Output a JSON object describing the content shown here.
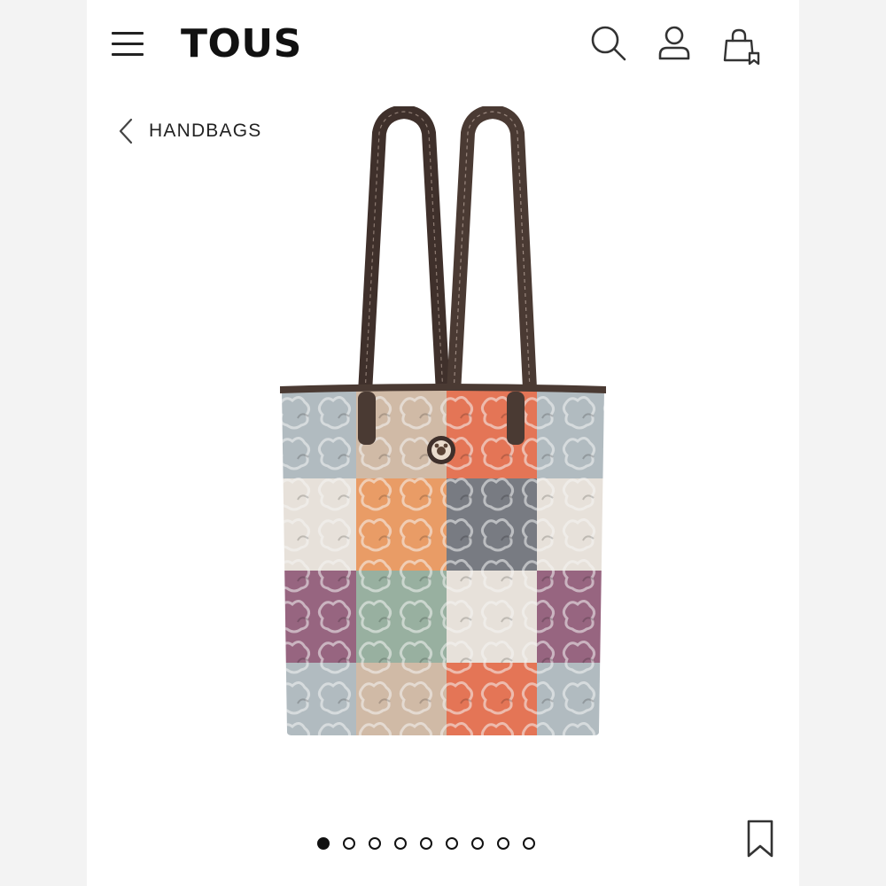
{
  "header": {
    "brand": "TOUS",
    "icons": [
      "menu-icon",
      "search-icon",
      "user-icon",
      "shopping-bag-icon"
    ]
  },
  "breadcrumb": {
    "label": "HANDBAGS",
    "icon": "chevron-left-icon"
  },
  "product": {
    "image": "tote-bag-image",
    "colors": {
      "strap": "#4a3a33",
      "blue_grey": "#b9c3c8",
      "beige": "#d9c2ad",
      "coral": "#ee7a5a",
      "orange": "#f3a36b",
      "charcoal": "#7d8088",
      "cream": "#f1ebe3",
      "plum": "#9e6a86",
      "sage": "#9fb8a7"
    }
  },
  "carousel": {
    "total": 9,
    "active_index": 0
  },
  "actions": {
    "bookmark_icon": "bookmark-icon"
  }
}
